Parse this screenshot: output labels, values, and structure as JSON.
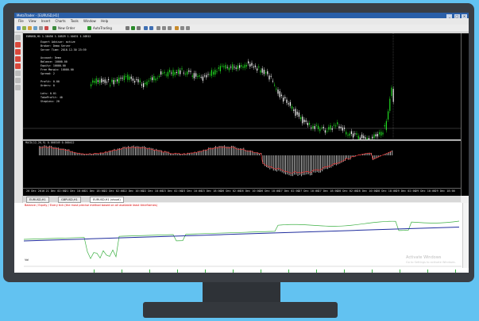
{
  "window": {
    "title": "MetaTrader - [EURUSD,H1]",
    "controls": [
      "_",
      "□",
      "×"
    ]
  },
  "menu": [
    "File",
    "View",
    "Insert",
    "Charts",
    "Tools",
    "Window",
    "Help"
  ],
  "toolbar": {
    "new_order_label": "New Order",
    "autotrading_label": "AutoTrading"
  },
  "chart": {
    "symbol_header": "EURUSD,H1 1.10456 1.10529 1.10431 1.10512",
    "indicator_header": "MACD(12,26,9) 0.000349 0.000412",
    "info_lines": [
      "Expert Advisor: active",
      "Broker: Demo Server",
      "Server Time: 2016.12.30 23:59",
      "",
      "Account: Demo",
      "Balance: 10000.00",
      "Equity: 10000.00",
      "Free Margin: 10000.00",
      "Spread: 2",
      "",
      "Profit: 0.00",
      "Orders: 0",
      "",
      "Lots: 0.01",
      "TakeProfit: 40",
      "StopLoss: 20"
    ],
    "time_ticks": [
      "20 Dec 2016",
      "21 Dec 02:00",
      "21 Dec 10:00",
      "21 Dec 18:00",
      "22 Dec 02:00",
      "22 Dec 10:00",
      "22 Dec 18:00",
      "23 Dec 02:00",
      "23 Dec 10:00",
      "23 Dec 18:00",
      "26 Dec 02:00",
      "26 Dec 10:00",
      "26 Dec 18:00",
      "27 Dec 02:00",
      "27 Dec 10:00",
      "27 Dec 18:00",
      "28 Dec 02:00",
      "28 Dec 10:00",
      "28 Dec 18:00",
      "29 Dec 02:00",
      "29 Dec 10:00",
      "29 Dec 18:00"
    ]
  },
  "tabs": [
    {
      "label": "EURUSD,H1",
      "active": false
    },
    {
      "label": "GBPUSD,H1",
      "active": false
    },
    {
      "label": "EURUSD,H1 (visual)",
      "active": true
    }
  ],
  "report": {
    "title": "Balance / Equity / Every tick (the most precise method based on all available least timeframes)",
    "volume_label": "Vol",
    "watermark_line1": "Activate Windows",
    "watermark_line2": "Go to Settings to activate Windows."
  },
  "colors": {
    "candle_up": "#22dd22",
    "candle_down": "#ffffff",
    "macd_signal": "#ff2a2a",
    "balance_line": "#1f2d9e",
    "equity_line": "#3cb043"
  }
}
